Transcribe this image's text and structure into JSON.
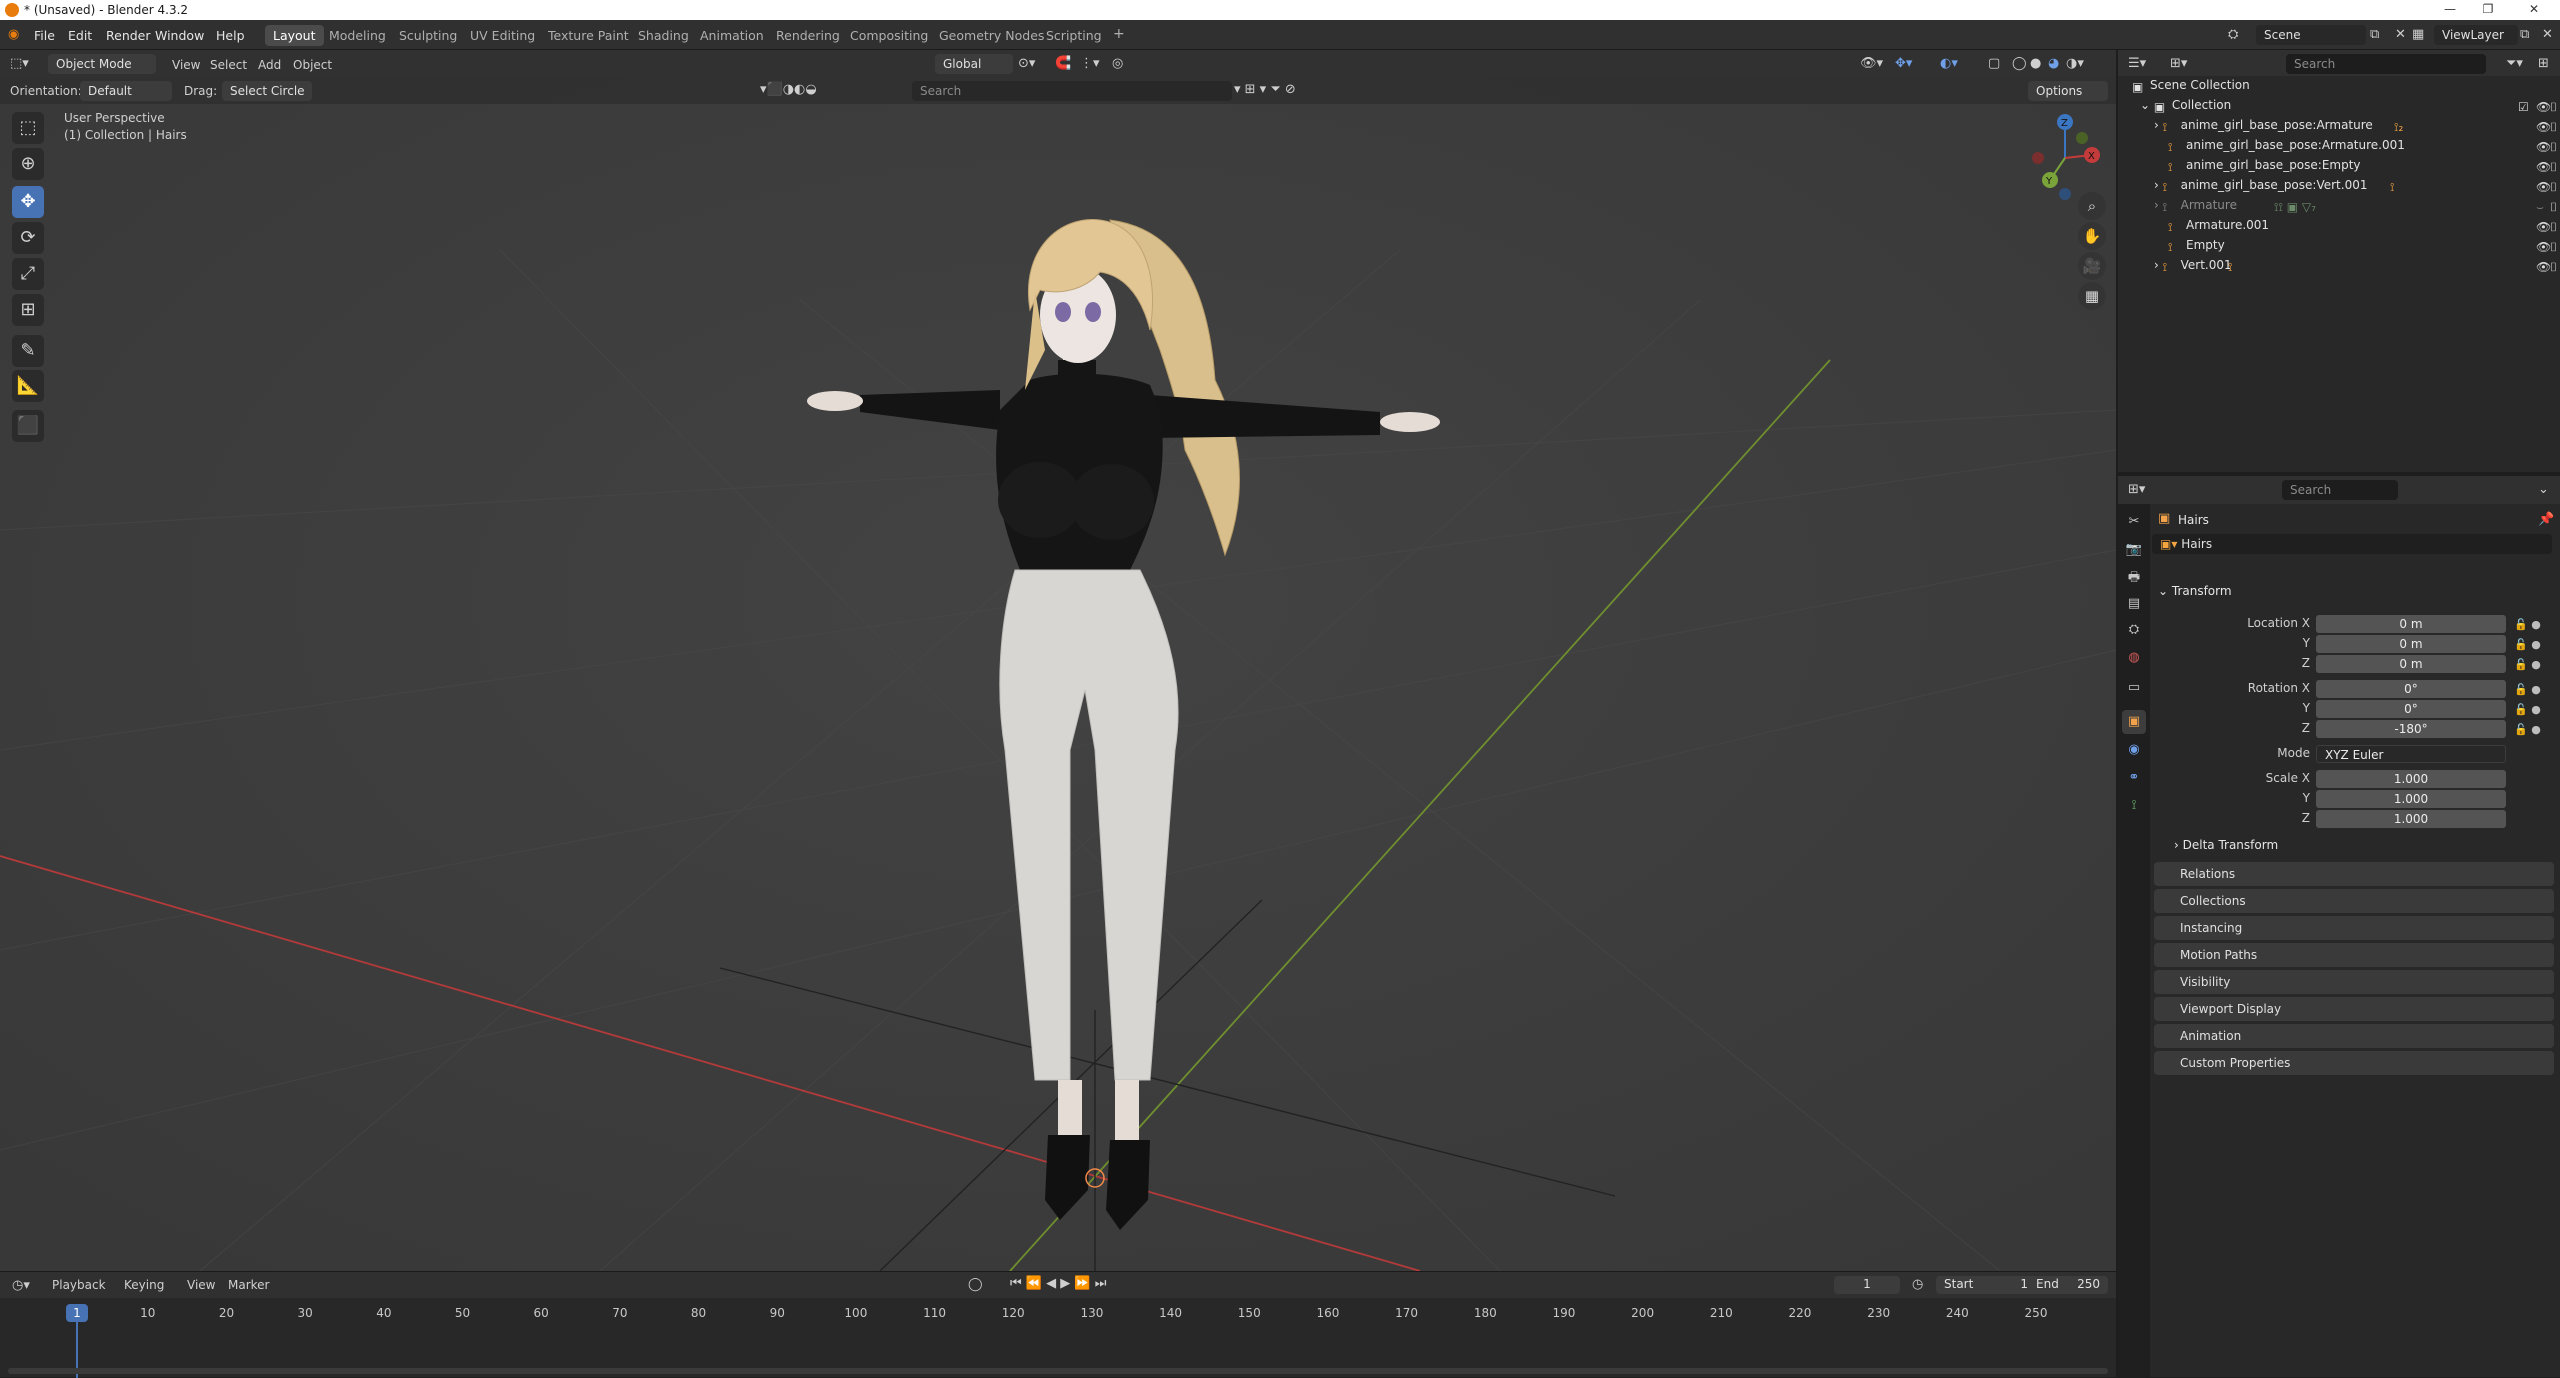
{
  "titlebar": {
    "title": "* (Unsaved) - Blender 4.3.2",
    "minimize": "—",
    "maximize": "❐",
    "close": "✕"
  },
  "menu": {
    "file": "File",
    "edit": "Edit",
    "render": "Render",
    "window": "Window",
    "help": "Help"
  },
  "workspaces": [
    "Layout",
    "Modeling",
    "Sculpting",
    "UV Editing",
    "Texture Paint",
    "Shading",
    "Animation",
    "Rendering",
    "Compositing",
    "Geometry Nodes",
    "Scripting"
  ],
  "add_workspace": "+",
  "scene": {
    "scene_label": "Scene",
    "viewlayer_label": "ViewLayer"
  },
  "viewport_header": {
    "mode": "Object Mode",
    "menus": {
      "view": "View",
      "select": "Select",
      "add": "Add",
      "object": "Object"
    },
    "transform_orientation": "Global",
    "search_placeholder": "Search",
    "orientation_label": "Orientation:",
    "orientation_value": "Default",
    "drag_label": "Drag:",
    "drag_value": "Select Circle",
    "options": "Options"
  },
  "viewport": {
    "perspective": "User Perspective",
    "collection_info": "(1) Collection | Hairs",
    "gizmo_axes": {
      "x": "X",
      "y": "Y",
      "z": "Z"
    }
  },
  "outliner": {
    "search_placeholder": "Search",
    "scene_collection": "Scene Collection",
    "collection": "Collection",
    "items": [
      {
        "name": "anime_girl_base_pose:Armature",
        "expandable": true,
        "dim": false
      },
      {
        "name": "anime_girl_base_pose:Armature.001",
        "expandable": false,
        "dim": false
      },
      {
        "name": "anime_girl_base_pose:Empty",
        "expandable": false,
        "dim": false
      },
      {
        "name": "anime_girl_base_pose:Vert.001",
        "expandable": true,
        "dim": false
      },
      {
        "name": "Armature",
        "expandable": true,
        "dim": true
      },
      {
        "name": "Armature.001",
        "expandable": false,
        "dim": false
      },
      {
        "name": "Empty",
        "expandable": false,
        "dim": false
      },
      {
        "name": "Vert.001",
        "expandable": true,
        "dim": false
      }
    ]
  },
  "properties": {
    "search_placeholder": "Search",
    "object_header": "Hairs",
    "object_name": "Hairs",
    "transform_title": "Transform",
    "location": {
      "label_x": "Location X",
      "label_y": "Y",
      "label_z": "Z",
      "x": "0 m",
      "y": "0 m",
      "z": "0 m"
    },
    "rotation": {
      "label_x": "Rotation X",
      "label_y": "Y",
      "label_z": "Z",
      "x": "0°",
      "y": "0°",
      "z": "-180°"
    },
    "mode": {
      "label": "Mode",
      "value": "XYZ Euler"
    },
    "scale": {
      "label_x": "Scale X",
      "label_y": "Y",
      "label_z": "Z",
      "x": "1.000",
      "y": "1.000",
      "z": "1.000"
    },
    "delta_transform": "Delta Transform",
    "panels": [
      "Relations",
      "Collections",
      "Instancing",
      "Motion Paths",
      "Visibility",
      "Viewport Display",
      "Animation",
      "Custom Properties"
    ]
  },
  "timeline": {
    "menus": {
      "playback": "Playback",
      "keying": "Keying",
      "view": "View",
      "marker": "Marker"
    },
    "current_frame": "1",
    "start_label": "Start",
    "start": "1",
    "end_label": "End",
    "end": "250",
    "ticks": [
      "1",
      "10",
      "20",
      "30",
      "40",
      "50",
      "60",
      "70",
      "80",
      "90",
      "100",
      "110",
      "120",
      "130",
      "140",
      "150",
      "160",
      "170",
      "180",
      "190",
      "200",
      "210",
      "220",
      "230",
      "240",
      "250"
    ],
    "playhead_label": "1"
  },
  "colors": {
    "active_tool": "#4772b3",
    "accent_orange": "#f4a440",
    "x_axis": "#c33b3b",
    "y_axis": "#7aa33a",
    "z_axis": "#3b76c3"
  }
}
